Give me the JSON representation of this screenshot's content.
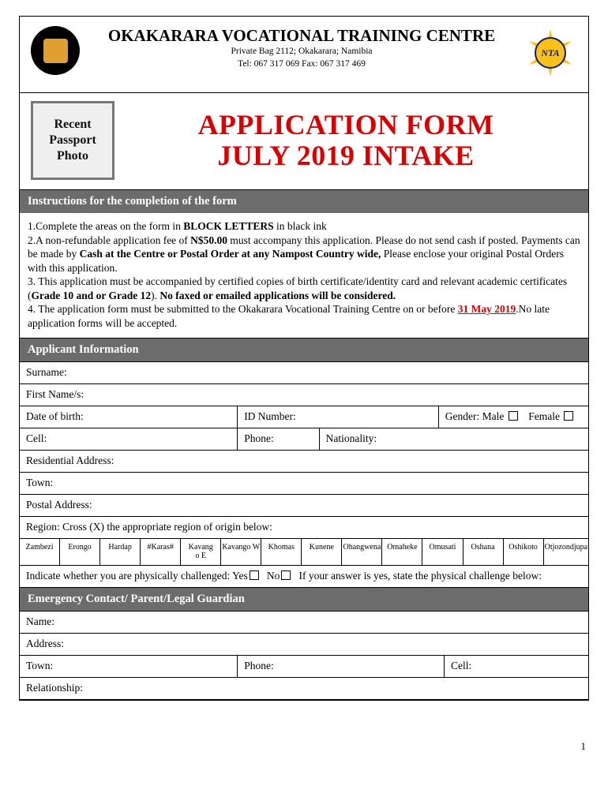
{
  "header": {
    "org": "OKAKARARA VOCATIONAL TRAINING CENTRE",
    "addr1": "Private Bag 2112; Okakarara; Namibia",
    "addr2": "Tel: 067 317 069 Fax: 067 317 469",
    "right_logo_text": "NTA"
  },
  "photo_box": "Recent\nPassport\nPhoto",
  "form_title_line1": "APPLICATION FORM",
  "form_title_line2": "JULY 2019 INTAKE",
  "section_instructions_head": "Instructions for the completion of the form",
  "instructions": {
    "line1_a": "1.Complete the areas on the form in ",
    "line1_b": "BLOCK LETTERS",
    "line1_c": " in black ink",
    "line2_a": "2.A non-refundable application fee of ",
    "line2_b": "N$50.00",
    "line2_c": " must accompany this application. Please do not send cash if posted. Payments can be made by ",
    "line2_d": "Cash at the Centre or Postal Order at any Nampost Country wide,",
    "line2_e": "  Please enclose your original  Postal Orders with this application.",
    "line3_a": "3. This application must be accompanied by certified copies of birth certificate/identity card and relevant academic certificates (",
    "line3_b": "Grade 10 and or Grade 12",
    "line3_c": "). ",
    "line3_d": "No faxed or emailed applications will be considered.",
    "line4_a": "4. The application form must be submitted to the Okakarara Vocational Training Centre on or before ",
    "line4_b": "31 May 2019",
    "line4_c": ".No late application forms will be accepted."
  },
  "section_applicant_head": "Applicant Information",
  "applicant": {
    "surname": "Surname:",
    "firstnames": "First Name/s:",
    "dob": "Date of birth:",
    "id": "ID Number:",
    "gender": "Gender: Male",
    "gender_female": "Female",
    "cell": "Cell:",
    "phone": "Phone:",
    "nationality": "Nationality:",
    "residential": "Residential Address:",
    "town": "Town:",
    "postal": "Postal Address:",
    "region_label": "Region: Cross (X) the appropriate region of origin below:",
    "phys_a": "Indicate whether you are physically challenged: Yes",
    "phys_b": "No",
    "phys_c": "If your answer is yes, state the physical challenge below:"
  },
  "regions": [
    "Zambezi",
    "Erongo",
    "Hardap",
    "#Karas#",
    "Kavang\no E",
    "Kavango W",
    "Khomas",
    "Kunene",
    "Ohangwena",
    "Omaheke",
    "Omusati",
    "Oshana",
    "Oshikoto",
    "Otjozondjupa"
  ],
  "section_emergency_head": "Emergency Contact/ Parent/Legal Guardian",
  "emergency": {
    "name": "Name:",
    "address": "Address:",
    "town": "Town:",
    "phone": "Phone:",
    "cell": "Cell:",
    "relationship": "Relationship:"
  },
  "page_number": "1"
}
